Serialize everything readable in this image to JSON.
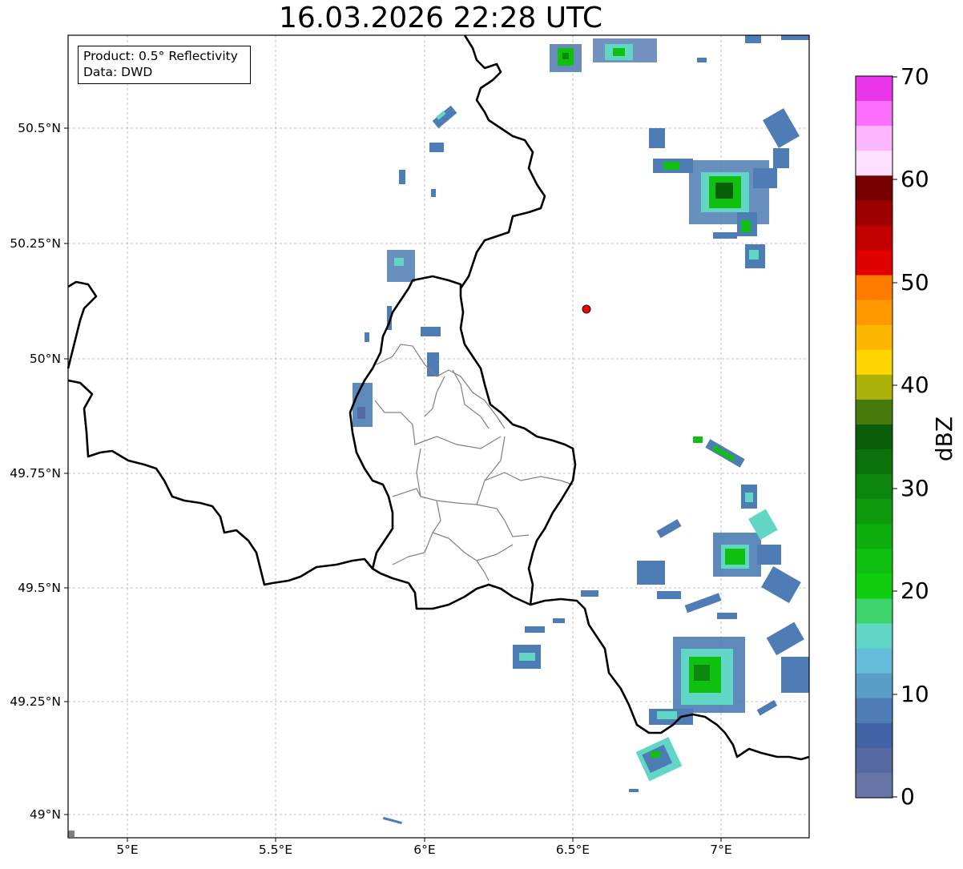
{
  "title": "16.03.2026 22:28 UTC",
  "info_box": {
    "product": "Product: 0.5° Reflectivity",
    "data": "Data: DWD"
  },
  "lat_ticks": [
    "50.5°N",
    "50.25°N",
    "50°N",
    "49.75°N",
    "49.5°N",
    "49.25°N",
    "49°N"
  ],
  "lon_ticks": [
    "5°E",
    "5.5°E",
    "6°E",
    "6.5°E",
    "7°E"
  ],
  "colorbar": {
    "label": "dBZ",
    "ticks": [
      "70",
      "60",
      "50",
      "40",
      "30",
      "20",
      "10",
      "0"
    ],
    "colors": [
      "#ea36ea",
      "#fc6efc",
      "#fcb6fc",
      "#fde0fd",
      "#760000",
      "#9e0000",
      "#c20000",
      "#e10000",
      "#fe7b00",
      "#fe9a00",
      "#fdb700",
      "#fdd500",
      "#acb20a",
      "#467a0a",
      "#0a5e0a",
      "#0b720b",
      "#0c860c",
      "#0d9a0d",
      "#0fae0f",
      "#10c010",
      "#10cd10",
      "#3ed46b",
      "#62d6c4",
      "#65bddc",
      "#5a9ec8",
      "#4d7db4",
      "#4263a6",
      "#5668a0",
      "#6675a6"
    ]
  },
  "radar_site": {
    "name": "radar-site",
    "color": "#ff0000"
  }
}
